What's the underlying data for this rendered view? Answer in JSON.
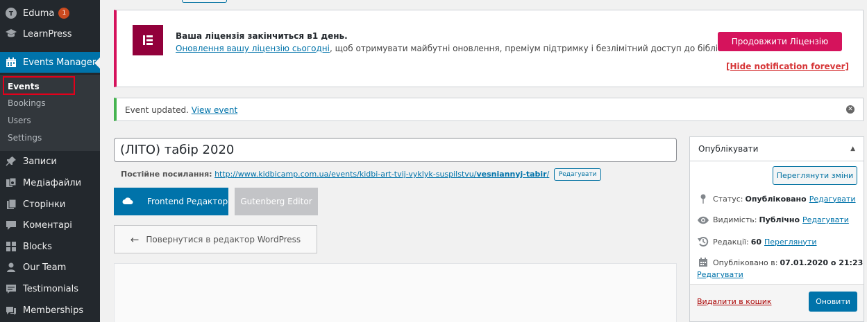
{
  "sidebar": {
    "items": [
      {
        "label": "Eduma",
        "icon": "theme-icon",
        "badge": "1"
      },
      {
        "label": "LearnPress",
        "icon": "graduation-cap-icon"
      },
      {
        "label": "Events Manager",
        "icon": "calendar-icon"
      },
      {
        "label": "Записи",
        "icon": "pin-icon"
      },
      {
        "label": "Медіафайли",
        "icon": "media-icon"
      },
      {
        "label": "Сторінки",
        "icon": "pages-icon"
      },
      {
        "label": "Коментарі",
        "icon": "comment-icon"
      },
      {
        "label": "Blocks",
        "icon": "blocks-icon"
      },
      {
        "label": "Our Team",
        "icon": "user-icon"
      },
      {
        "label": "Testimonials",
        "icon": "testimonial-icon"
      },
      {
        "label": "Memberships",
        "icon": "memberships-icon"
      }
    ],
    "submenu": [
      "Events",
      "Bookings",
      "Users",
      "Settings"
    ]
  },
  "elementor_notice": {
    "title": "Ваша ліцензія закінчиться в1 день.",
    "link_text": "Оновлення вашу ліцензію сьогодні",
    "text_after": ", щоб отримувати майбутні оновлення, преміум підтримку і безлімітний доступ до бібліотеки шаблонів.",
    "button": "Продовжити Ліцензію",
    "hide": "[Hide notification forever]"
  },
  "update_notice": {
    "text": "Event updated.",
    "link": "View event"
  },
  "editor": {
    "title": "(ЛІТО) табір 2020",
    "permalink_label": "Постійне посилання:",
    "permalink_base": "http://www.kidbicamp.com.ua/events/kidbi-art-tvij-vyklyk-suspilstvu/",
    "permalink_slug": "vesniannyj-tabir",
    "permalink_end": "/",
    "edit_slug": "Редагувати",
    "frontend_btn": "Frontend Редактор",
    "gutenberg_btn": "Gutenberg Editor",
    "back_btn": "Повернутися в редактор WordPress"
  },
  "publish": {
    "title": "Опублікувати",
    "preview": "Переглянути зміни",
    "status_label": "Статус:",
    "status_value": "Опубліковано",
    "visibility_label": "Видимість:",
    "visibility_value": "Публічно",
    "revisions_label": "Редакції:",
    "revisions_value": "60",
    "revisions_link": "Переглянути",
    "published_label": "Опубліковано в:",
    "published_value": "07.01.2020 о 21:23",
    "edit": "Редагувати",
    "trash": "Видалити в кошик",
    "update": "Оновити"
  },
  "colors": {
    "sidebar_bg": "#23282d",
    "accent": "#0073aa",
    "elementor": "#d5135c",
    "success": "#46b450"
  }
}
